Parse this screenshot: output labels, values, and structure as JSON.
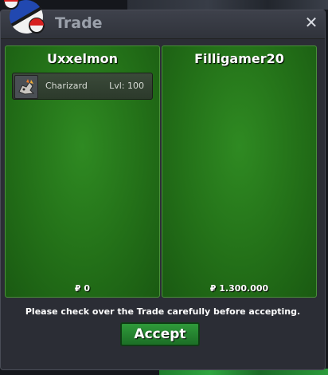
{
  "window": {
    "title": "Trade",
    "close_glyph": "✕"
  },
  "left_panel": {
    "player_name": "Uxxelmon",
    "pokemon": [
      {
        "name": "Charizard",
        "level": "Lvl: 100",
        "icon": "charizard-icon"
      }
    ],
    "money": "₽ 0"
  },
  "right_panel": {
    "player_name": "Filligamer20",
    "pokemon": [],
    "money": "₽ 1.300.000"
  },
  "notice": "Please check over the Trade carefully before accepting.",
  "accept_label": "Accept",
  "colors": {
    "panel_green": "#237018",
    "accept_green": "#2f9a3a",
    "window_bg": "#2b2d35"
  }
}
